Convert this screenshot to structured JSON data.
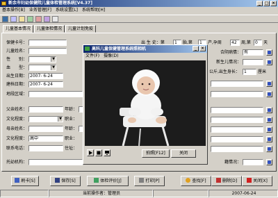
{
  "window": {
    "title": "新余市妇幼保健院儿童体检管理系统[V4.37]",
    "min": "_",
    "max": "□",
    "close": "×"
  },
  "menu": [
    "基本操作[B]",
    "业务管理[F]",
    "系统设置[L]",
    "系统帮助[H]"
  ],
  "tabs": [
    "儿童基本情况",
    "儿童体检情况",
    "儿童计划免疫"
  ],
  "form": {
    "card_no": "保健卡号：",
    "child_name": "儿童姓名：",
    "sex": "性　　别：",
    "blood": "血　　型：",
    "birth_date": "出生日期：",
    "birth_date_value": "2007- 6-24",
    "record_date": "建档日期：",
    "record_date_value": "2007- 6-24",
    "district": "地段区域：",
    "father_name": "父亲姓名：",
    "father_age": "年龄：",
    "education1": "文化程度：",
    "occupation1": "职业：",
    "mother_name": "母亲姓名：",
    "mother_age": "年龄：",
    "education2": "文化程度：",
    "education2_value": "高中",
    "occupation2": "职业：",
    "phone": "联系电话：",
    "address": "住址：",
    "nursery": "托幼机构：",
    "birth_history_lbl": "出 生 史：第",
    "birth_history_val": "1",
    "birth_history_mid": "胎,第",
    "parity_val": "1",
    "parity_unit": "产,孕周",
    "gest_week_val": "42",
    "week_unit": "周,第",
    "week_day_val": "0",
    "day_unit": "天",
    "consang_lbl": "合阴病情：",
    "consang_val": "有",
    "neonatal_lbl": "新生儿情况：",
    "cm_lbl": "公斤,出生身长：",
    "cm_val": "1",
    "cm_unit": "厘米",
    "care_lbl": "籍情况："
  },
  "popup": {
    "title": "高科儿童保健管理系统照相机",
    "menu": [
      "文件(F)",
      "摄像(D)"
    ],
    "capture": "拍照[F12]",
    "close": "关闭"
  },
  "buttons": [
    "刷卡[S]",
    "保存[S]",
    "体检评价[J]",
    "打印[P]",
    "查找[F]",
    "删除[D]",
    "关闭[X]"
  ],
  "status": {
    "operator": "当前操作者：管理员",
    "date": "2007-06-24"
  },
  "colors": {
    "title_start": "#0a246a",
    "title_end": "#a6caf0",
    "face": "#d4d0c8"
  }
}
